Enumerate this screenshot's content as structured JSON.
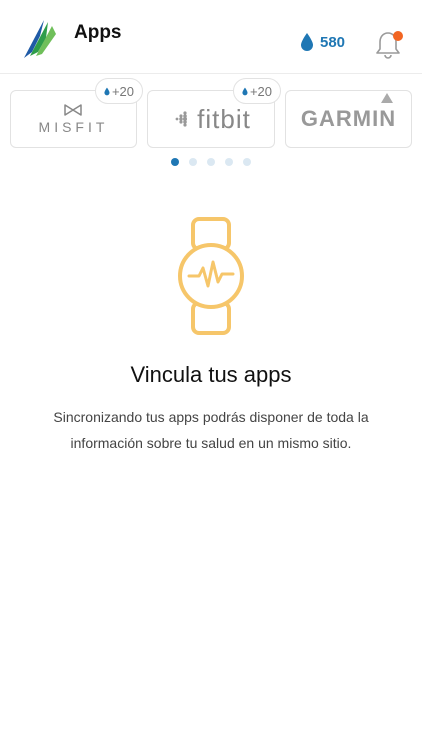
{
  "header": {
    "title": "Apps",
    "drops_count": "580",
    "logo_icon": "mountain-logo-icon",
    "drop_icon": "water-drop-icon",
    "notification_icon": "bell-icon",
    "notification_dot_color": "#f26522",
    "accent_color": "#1f77b4"
  },
  "carousel": {
    "cards": [
      {
        "name": "MISFIT",
        "reward": "+20"
      },
      {
        "name": "fitbit",
        "reward": "+20"
      },
      {
        "name": "GARMIN"
      }
    ],
    "pages": 5,
    "active_page": 1
  },
  "empty_state": {
    "icon": "smartwatch-heartbeat-icon",
    "icon_color": "#f6c66a",
    "title": "Vincula tus apps",
    "text": "Sincronizando tus apps podrás disponer de toda la información sobre tu salud en un mismo sitio."
  }
}
